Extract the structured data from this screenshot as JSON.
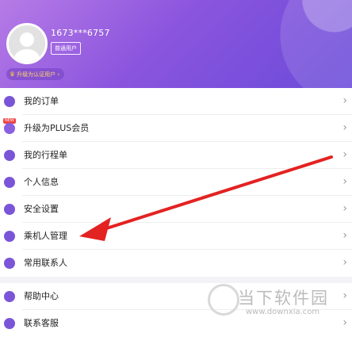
{
  "profile": {
    "phone": "1673***6757",
    "badge": "普通用户",
    "upgrade": "升级为认证用户"
  },
  "menu_group1": [
    {
      "label": "我的订单",
      "icon": "order-icon"
    },
    {
      "label": "升级为PLUS会员",
      "icon": "crown-icon",
      "tag": "NEW"
    },
    {
      "label": "我的行程单",
      "icon": "itinerary-icon"
    },
    {
      "label": "个人信息",
      "icon": "person-icon"
    },
    {
      "label": "安全设置",
      "icon": "shield-icon"
    },
    {
      "label": "乘机人管理",
      "icon": "passenger-icon"
    },
    {
      "label": "常用联系人",
      "icon": "contacts-icon"
    }
  ],
  "menu_group2": [
    {
      "label": "帮助中心",
      "icon": "help-icon"
    },
    {
      "label": "联系客服",
      "icon": "phone-icon"
    }
  ],
  "chevron": "›",
  "watermark": {
    "text": "当下软件园",
    "url": "www.downxia.com"
  },
  "colors": {
    "accent": "#7b55d8",
    "arrow": "#e32222"
  }
}
